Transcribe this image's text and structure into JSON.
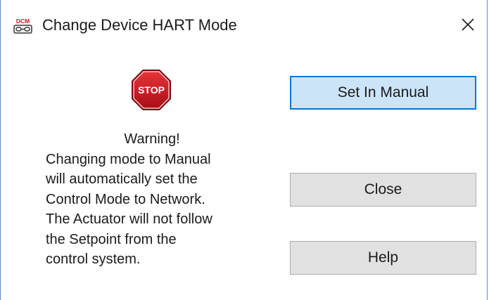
{
  "window": {
    "title": "Change Device HART Mode",
    "app_icon_text": "DCM",
    "close_glyph": "✕"
  },
  "warning": {
    "stop_sign_text": "STOP",
    "title": "Warning!",
    "lines": [
      "Changing mode to Manual",
      "will automatically set the",
      "Control Mode to Network.",
      "The Actuator will not follow",
      "the Setpoint from the",
      "control system."
    ]
  },
  "buttons": {
    "set_in_manual": "Set In Manual",
    "close": "Close",
    "help": "Help"
  },
  "colors": {
    "primary_button_bg": "#cce4f7",
    "primary_button_border": "#0078d7",
    "button_bg": "#e1e1e1",
    "stop_red": "#c7161d",
    "window_border": "#5b8fd1"
  },
  "icons": {
    "app": "dcm-app-icon",
    "stop": "stop-sign-icon",
    "close": "close-icon"
  }
}
